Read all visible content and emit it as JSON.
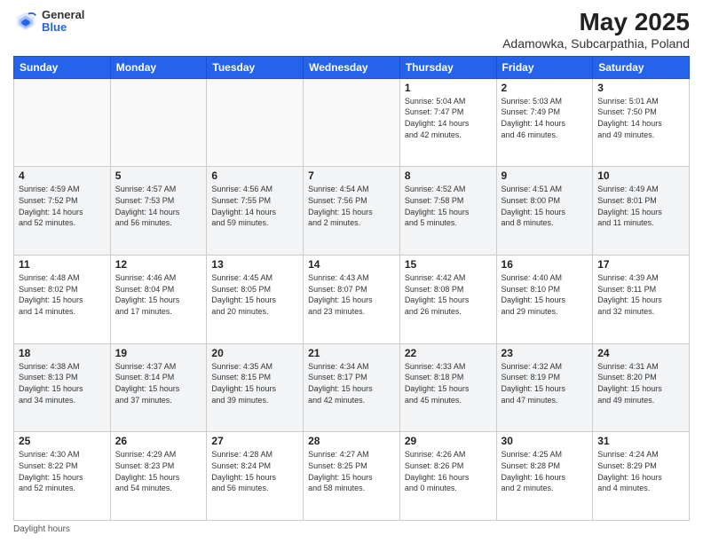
{
  "header": {
    "logo_general": "General",
    "logo_blue": "Blue",
    "title": "May 2025",
    "subtitle": "Adamowka, Subcarpathia, Poland"
  },
  "days_of_week": [
    "Sunday",
    "Monday",
    "Tuesday",
    "Wednesday",
    "Thursday",
    "Friday",
    "Saturday"
  ],
  "footer": {
    "daylight_label": "Daylight hours"
  },
  "weeks": [
    [
      {
        "day": "",
        "info": ""
      },
      {
        "day": "",
        "info": ""
      },
      {
        "day": "",
        "info": ""
      },
      {
        "day": "",
        "info": ""
      },
      {
        "day": "1",
        "info": "Sunrise: 5:04 AM\nSunset: 7:47 PM\nDaylight: 14 hours\nand 42 minutes."
      },
      {
        "day": "2",
        "info": "Sunrise: 5:03 AM\nSunset: 7:49 PM\nDaylight: 14 hours\nand 46 minutes."
      },
      {
        "day": "3",
        "info": "Sunrise: 5:01 AM\nSunset: 7:50 PM\nDaylight: 14 hours\nand 49 minutes."
      }
    ],
    [
      {
        "day": "4",
        "info": "Sunrise: 4:59 AM\nSunset: 7:52 PM\nDaylight: 14 hours\nand 52 minutes."
      },
      {
        "day": "5",
        "info": "Sunrise: 4:57 AM\nSunset: 7:53 PM\nDaylight: 14 hours\nand 56 minutes."
      },
      {
        "day": "6",
        "info": "Sunrise: 4:56 AM\nSunset: 7:55 PM\nDaylight: 14 hours\nand 59 minutes."
      },
      {
        "day": "7",
        "info": "Sunrise: 4:54 AM\nSunset: 7:56 PM\nDaylight: 15 hours\nand 2 minutes."
      },
      {
        "day": "8",
        "info": "Sunrise: 4:52 AM\nSunset: 7:58 PM\nDaylight: 15 hours\nand 5 minutes."
      },
      {
        "day": "9",
        "info": "Sunrise: 4:51 AM\nSunset: 8:00 PM\nDaylight: 15 hours\nand 8 minutes."
      },
      {
        "day": "10",
        "info": "Sunrise: 4:49 AM\nSunset: 8:01 PM\nDaylight: 15 hours\nand 11 minutes."
      }
    ],
    [
      {
        "day": "11",
        "info": "Sunrise: 4:48 AM\nSunset: 8:02 PM\nDaylight: 15 hours\nand 14 minutes."
      },
      {
        "day": "12",
        "info": "Sunrise: 4:46 AM\nSunset: 8:04 PM\nDaylight: 15 hours\nand 17 minutes."
      },
      {
        "day": "13",
        "info": "Sunrise: 4:45 AM\nSunset: 8:05 PM\nDaylight: 15 hours\nand 20 minutes."
      },
      {
        "day": "14",
        "info": "Sunrise: 4:43 AM\nSunset: 8:07 PM\nDaylight: 15 hours\nand 23 minutes."
      },
      {
        "day": "15",
        "info": "Sunrise: 4:42 AM\nSunset: 8:08 PM\nDaylight: 15 hours\nand 26 minutes."
      },
      {
        "day": "16",
        "info": "Sunrise: 4:40 AM\nSunset: 8:10 PM\nDaylight: 15 hours\nand 29 minutes."
      },
      {
        "day": "17",
        "info": "Sunrise: 4:39 AM\nSunset: 8:11 PM\nDaylight: 15 hours\nand 32 minutes."
      }
    ],
    [
      {
        "day": "18",
        "info": "Sunrise: 4:38 AM\nSunset: 8:13 PM\nDaylight: 15 hours\nand 34 minutes."
      },
      {
        "day": "19",
        "info": "Sunrise: 4:37 AM\nSunset: 8:14 PM\nDaylight: 15 hours\nand 37 minutes."
      },
      {
        "day": "20",
        "info": "Sunrise: 4:35 AM\nSunset: 8:15 PM\nDaylight: 15 hours\nand 39 minutes."
      },
      {
        "day": "21",
        "info": "Sunrise: 4:34 AM\nSunset: 8:17 PM\nDaylight: 15 hours\nand 42 minutes."
      },
      {
        "day": "22",
        "info": "Sunrise: 4:33 AM\nSunset: 8:18 PM\nDaylight: 15 hours\nand 45 minutes."
      },
      {
        "day": "23",
        "info": "Sunrise: 4:32 AM\nSunset: 8:19 PM\nDaylight: 15 hours\nand 47 minutes."
      },
      {
        "day": "24",
        "info": "Sunrise: 4:31 AM\nSunset: 8:20 PM\nDaylight: 15 hours\nand 49 minutes."
      }
    ],
    [
      {
        "day": "25",
        "info": "Sunrise: 4:30 AM\nSunset: 8:22 PM\nDaylight: 15 hours\nand 52 minutes."
      },
      {
        "day": "26",
        "info": "Sunrise: 4:29 AM\nSunset: 8:23 PM\nDaylight: 15 hours\nand 54 minutes."
      },
      {
        "day": "27",
        "info": "Sunrise: 4:28 AM\nSunset: 8:24 PM\nDaylight: 15 hours\nand 56 minutes."
      },
      {
        "day": "28",
        "info": "Sunrise: 4:27 AM\nSunset: 8:25 PM\nDaylight: 15 hours\nand 58 minutes."
      },
      {
        "day": "29",
        "info": "Sunrise: 4:26 AM\nSunset: 8:26 PM\nDaylight: 16 hours\nand 0 minutes."
      },
      {
        "day": "30",
        "info": "Sunrise: 4:25 AM\nSunset: 8:28 PM\nDaylight: 16 hours\nand 2 minutes."
      },
      {
        "day": "31",
        "info": "Sunrise: 4:24 AM\nSunset: 8:29 PM\nDaylight: 16 hours\nand 4 minutes."
      }
    ]
  ]
}
